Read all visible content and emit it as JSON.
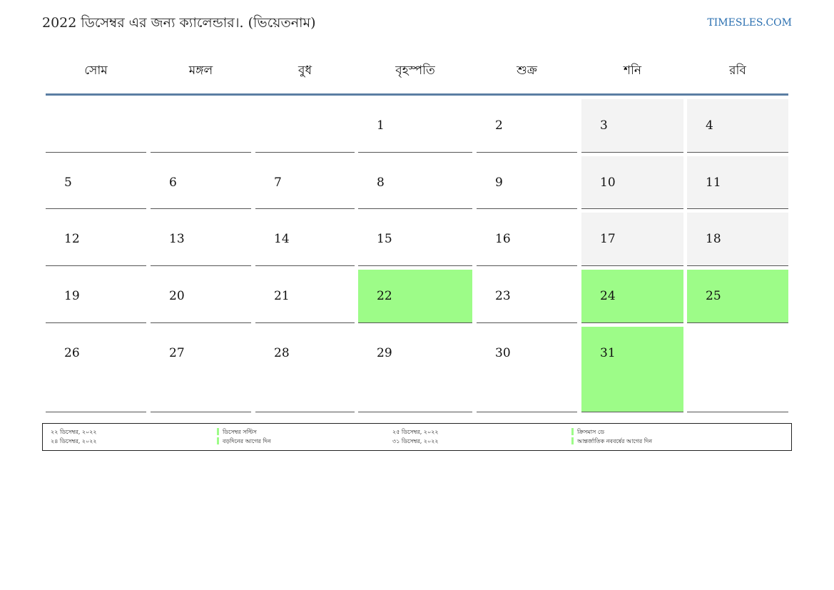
{
  "header": {
    "title": "2022 ডিসেম্বর এর জন্য ক্যালেন্ডার।. (ভিয়েতনাম)",
    "site": "TIMESLES.COM"
  },
  "colors": {
    "holiday": "#9dfc88",
    "weekend": "#f3f3f3",
    "header_line": "#5b7ea3",
    "link": "#2a6fb0"
  },
  "weekdays": [
    "সোম",
    "মঙ্গল",
    "বুধ",
    "বৃহস্পতি",
    "শুক্র",
    "শনি",
    "রবি"
  ],
  "weeks": [
    [
      {
        "day": "",
        "type": "normal"
      },
      {
        "day": "",
        "type": "normal"
      },
      {
        "day": "",
        "type": "normal"
      },
      {
        "day": "1",
        "type": "normal"
      },
      {
        "day": "2",
        "type": "normal"
      },
      {
        "day": "3",
        "type": "weekend"
      },
      {
        "day": "4",
        "type": "weekend"
      }
    ],
    [
      {
        "day": "5",
        "type": "normal"
      },
      {
        "day": "6",
        "type": "normal"
      },
      {
        "day": "7",
        "type": "normal"
      },
      {
        "day": "8",
        "type": "normal"
      },
      {
        "day": "9",
        "type": "normal"
      },
      {
        "day": "10",
        "type": "weekend"
      },
      {
        "day": "11",
        "type": "weekend"
      }
    ],
    [
      {
        "day": "12",
        "type": "normal"
      },
      {
        "day": "13",
        "type": "normal"
      },
      {
        "day": "14",
        "type": "normal"
      },
      {
        "day": "15",
        "type": "normal"
      },
      {
        "day": "16",
        "type": "normal"
      },
      {
        "day": "17",
        "type": "weekend"
      },
      {
        "day": "18",
        "type": "weekend"
      }
    ],
    [
      {
        "day": "19",
        "type": "normal"
      },
      {
        "day": "20",
        "type": "normal"
      },
      {
        "day": "21",
        "type": "normal"
      },
      {
        "day": "22",
        "type": "holiday"
      },
      {
        "day": "23",
        "type": "normal"
      },
      {
        "day": "24",
        "type": "holiday"
      },
      {
        "day": "25",
        "type": "holiday"
      }
    ],
    [
      {
        "day": "26",
        "type": "normal"
      },
      {
        "day": "27",
        "type": "normal"
      },
      {
        "day": "28",
        "type": "normal"
      },
      {
        "day": "29",
        "type": "normal"
      },
      {
        "day": "30",
        "type": "normal"
      },
      {
        "day": "31",
        "type": "holiday"
      },
      {
        "day": "",
        "type": "normal"
      }
    ]
  ],
  "legend": [
    {
      "date": "২২ ডিসেম্বর, ২০২২",
      "name": "ডিসেম্বর সল্টিস"
    },
    {
      "date": "২৫ ডিসেম্বর, ২০২২",
      "name": "ক্রিসমাস ডে"
    },
    {
      "date": "২৪ ডিসেম্বর, ২০২২",
      "name": "বড়দিনের আগের দিন"
    },
    {
      "date": "৩১ ডিসেম্বর, ২০২২",
      "name": "আন্তর্জাতিক নববর্ষের আগের দিন"
    }
  ]
}
